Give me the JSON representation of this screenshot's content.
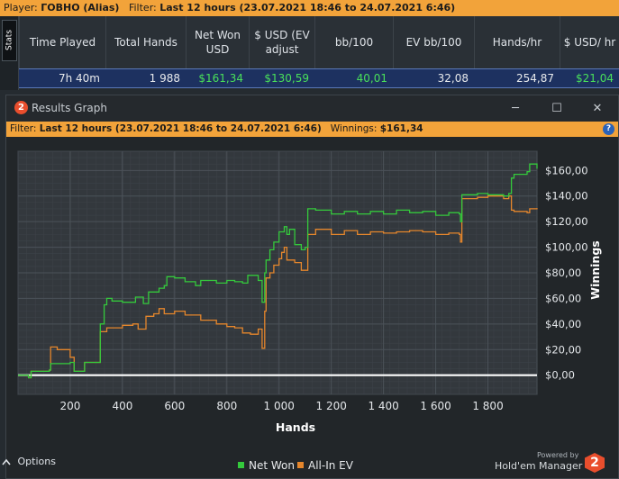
{
  "player_bar": {
    "player_label": "Player:",
    "player_name": "ГОВНО (Alias)",
    "filter_label": "Filter:",
    "filter_value": "Last 12 hours (23.07.2021 18:46 to 24.07.2021 6:46)"
  },
  "stats": {
    "tab_label": "Stats",
    "headers": [
      "Time Played",
      "Total Hands",
      "Net Won USD",
      "$ USD (EV adjust",
      "bb/100",
      "EV bb/100",
      "Hands/hr",
      "$ USD/ hr"
    ],
    "row": [
      "7h 40m",
      "1 988",
      "$161,34",
      "$130,59",
      "40,01",
      "32,08",
      "254,87",
      "$21,04"
    ]
  },
  "window": {
    "title": "Results Graph",
    "logo_text": "2",
    "minimize": "─",
    "maximize": "☐",
    "close": "✕",
    "filter_label": "Filter:",
    "filter_value": "Last 12 hours (23.07.2021 18:46 to 24.07.2021 6:46)",
    "winnings_label": "Winnings:",
    "winnings_value": "$161,34",
    "help": "?"
  },
  "footer": {
    "options": "Options",
    "legend_netwon": "Net Won",
    "legend_allin": "All-In EV",
    "powered": "Powered by",
    "brand": "Hold'em Manager",
    "brand_logo": "2"
  },
  "colors": {
    "net_won": "#34c93c",
    "allin_ev": "#e5862c",
    "zero_line": "#ffffff",
    "accent": "#f2a33a"
  },
  "chart_data": {
    "type": "line",
    "xlabel": "Hands",
    "ylabel": "Winnings",
    "xlim": [
      0,
      1988
    ],
    "ylim": [
      -15,
      175
    ],
    "xticks": [
      200,
      400,
      600,
      800,
      1000,
      1200,
      1400,
      1600,
      1800
    ],
    "xtick_labels": [
      "200",
      "400",
      "600",
      "800",
      "1 000",
      "1 200",
      "1 400",
      "1 600",
      "1 800"
    ],
    "yticks": [
      0,
      20,
      40,
      60,
      80,
      100,
      120,
      140,
      160
    ],
    "ytick_labels": [
      "$0,00",
      "$20,00",
      "$40,00",
      "$60,00",
      "$80,00",
      "$100,00",
      "$120,00",
      "$140,00",
      "$160,00"
    ],
    "grid": true,
    "series": [
      {
        "name": "Net Won",
        "color": "#34c93c",
        "points": [
          [
            0,
            0
          ],
          [
            40,
            -2
          ],
          [
            50,
            3
          ],
          [
            120,
            4
          ],
          [
            125,
            9
          ],
          [
            200,
            10
          ],
          [
            215,
            3
          ],
          [
            250,
            3
          ],
          [
            255,
            10
          ],
          [
            310,
            10
          ],
          [
            315,
            40
          ],
          [
            330,
            55
          ],
          [
            340,
            60
          ],
          [
            360,
            58
          ],
          [
            400,
            57
          ],
          [
            450,
            61
          ],
          [
            480,
            56
          ],
          [
            500,
            65
          ],
          [
            540,
            68
          ],
          [
            560,
            70
          ],
          [
            570,
            77
          ],
          [
            600,
            76
          ],
          [
            640,
            73
          ],
          [
            680,
            70
          ],
          [
            700,
            74
          ],
          [
            760,
            72
          ],
          [
            800,
            74
          ],
          [
            830,
            73
          ],
          [
            860,
            72
          ],
          [
            880,
            78
          ],
          [
            920,
            74
          ],
          [
            935,
            57
          ],
          [
            945,
            80
          ],
          [
            950,
            90
          ],
          [
            965,
            98
          ],
          [
            980,
            104
          ],
          [
            1000,
            112
          ],
          [
            1010,
            112
          ],
          [
            1020,
            116
          ],
          [
            1030,
            110
          ],
          [
            1040,
            114
          ],
          [
            1060,
            102
          ],
          [
            1085,
            98
          ],
          [
            1100,
            100
          ],
          [
            1110,
            130
          ],
          [
            1140,
            129
          ],
          [
            1200,
            126
          ],
          [
            1250,
            128
          ],
          [
            1300,
            126
          ],
          [
            1350,
            128
          ],
          [
            1400,
            126
          ],
          [
            1450,
            129
          ],
          [
            1500,
            127
          ],
          [
            1550,
            128
          ],
          [
            1600,
            125
          ],
          [
            1650,
            127
          ],
          [
            1690,
            126
          ],
          [
            1695,
            120
          ],
          [
            1700,
            141
          ],
          [
            1760,
            142
          ],
          [
            1800,
            141
          ],
          [
            1860,
            140
          ],
          [
            1880,
            142
          ],
          [
            1890,
            154
          ],
          [
            1900,
            157
          ],
          [
            1950,
            159
          ],
          [
            1960,
            165
          ],
          [
            1988,
            161.34
          ]
        ]
      },
      {
        "name": "All-In EV",
        "color": "#e5862c",
        "points": [
          [
            0,
            0
          ],
          [
            40,
            -2
          ],
          [
            50,
            3
          ],
          [
            120,
            4
          ],
          [
            125,
            22
          ],
          [
            150,
            20
          ],
          [
            200,
            14
          ],
          [
            215,
            3
          ],
          [
            250,
            3
          ],
          [
            255,
            10
          ],
          [
            310,
            10
          ],
          [
            315,
            34
          ],
          [
            340,
            37
          ],
          [
            400,
            39
          ],
          [
            440,
            40
          ],
          [
            460,
            36
          ],
          [
            490,
            46
          ],
          [
            520,
            48
          ],
          [
            540,
            52
          ],
          [
            560,
            48
          ],
          [
            600,
            50
          ],
          [
            640,
            47
          ],
          [
            700,
            43
          ],
          [
            760,
            40
          ],
          [
            800,
            38
          ],
          [
            830,
            37
          ],
          [
            860,
            33
          ],
          [
            890,
            32
          ],
          [
            920,
            36
          ],
          [
            935,
            21
          ],
          [
            945,
            50
          ],
          [
            950,
            76
          ],
          [
            965,
            80
          ],
          [
            980,
            86
          ],
          [
            1000,
            91
          ],
          [
            1010,
            96
          ],
          [
            1020,
            100
          ],
          [
            1030,
            90
          ],
          [
            1060,
            88
          ],
          [
            1085,
            82
          ],
          [
            1110,
            110
          ],
          [
            1140,
            114
          ],
          [
            1200,
            110
          ],
          [
            1250,
            113
          ],
          [
            1300,
            110
          ],
          [
            1350,
            112
          ],
          [
            1400,
            111
          ],
          [
            1450,
            112
          ],
          [
            1500,
            113
          ],
          [
            1550,
            112
          ],
          [
            1600,
            110
          ],
          [
            1650,
            111
          ],
          [
            1690,
            110
          ],
          [
            1695,
            104
          ],
          [
            1700,
            138
          ],
          [
            1760,
            139
          ],
          [
            1800,
            140
          ],
          [
            1860,
            138
          ],
          [
            1880,
            140
          ],
          [
            1890,
            129
          ],
          [
            1900,
            128
          ],
          [
            1950,
            127
          ],
          [
            1960,
            130
          ],
          [
            1988,
            130.59
          ]
        ]
      }
    ]
  }
}
